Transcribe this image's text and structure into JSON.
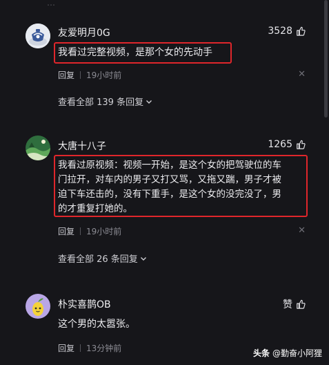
{
  "comments": [
    {
      "username": "友爱明月0G",
      "likes": "3528",
      "text": "我看过完整视频，是那个女的先动手",
      "reply_label": "回复",
      "time": "19小时前",
      "view_all": "查看全部 139 条回复"
    },
    {
      "username": "大唐十八子",
      "likes": "1265",
      "text_lines": [
        "我看过原视频：视频一开始，是这个女的把驾驶位的车",
        "门拉开，对车内的男子又打又骂，又拖又踹，男子才被",
        "迫下车还击的，没有下重手，是这个女的没完没了，男",
        "的才重复打她的。"
      ],
      "reply_label": "回复",
      "time": "19小时前",
      "view_all": "查看全部 26 条回复"
    },
    {
      "username": "朴实喜鹊OB",
      "likes": "赞",
      "text": "这个男的太嚣张。",
      "reply_label": "回复",
      "time": "13分钟前"
    }
  ],
  "watermark": {
    "brand": "头条",
    "author": "@勤奋小阿狸"
  },
  "colors": {
    "background": "#16161a",
    "highlight_border": "#e0262b",
    "meta_text": "#8c8c94"
  },
  "icons": [
    "thumbs-up-icon",
    "close-icon",
    "chevron-down-icon"
  ]
}
